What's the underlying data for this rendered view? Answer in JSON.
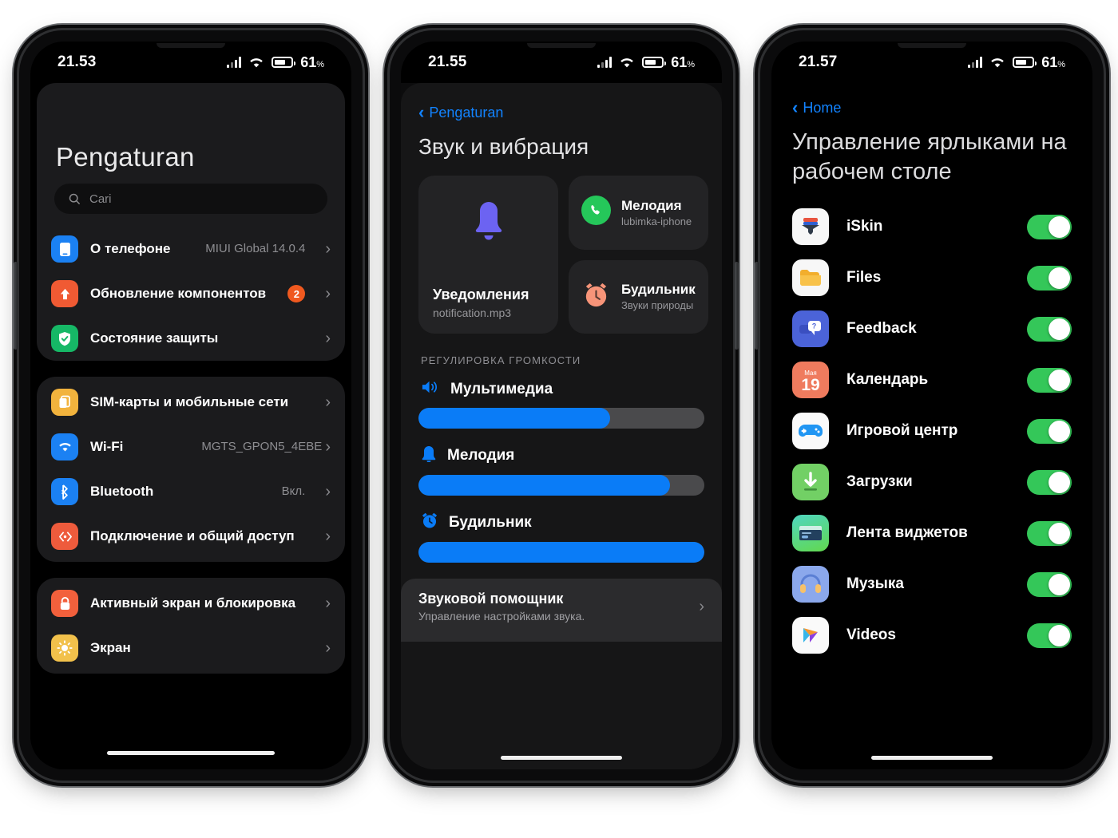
{
  "statusbar": {
    "time_phone1": "21.53",
    "time_phone2": "21.55",
    "time_phone3": "21.57",
    "battery_pct": "61",
    "battery_unit": "%"
  },
  "phone1": {
    "title": "Pengaturan",
    "search_placeholder": "Cari",
    "groups": [
      {
        "rows": [
          {
            "icon": "phone-info-icon",
            "label": "О телефоне",
            "value": "MIUI Global 14.0.4",
            "badge": "",
            "chevron": "›",
            "icon_color": "#1b81f3"
          },
          {
            "icon": "component-update-icon",
            "label": "Обновление компонентов",
            "value": "",
            "badge": "2",
            "chevron": "›",
            "icon_color": "#f05a33"
          },
          {
            "icon": "security-shield-icon",
            "label": "Состояние защиты",
            "value": "",
            "badge": "",
            "chevron": "›",
            "icon_color": "#16b866"
          }
        ]
      },
      {
        "rows": [
          {
            "icon": "sim-card-icon",
            "label": "SIM-карты и мобильные сети",
            "value": "",
            "badge": "",
            "chevron": "›",
            "icon_color": "#f2b33d"
          },
          {
            "icon": "wifi-icon",
            "label": "Wi-Fi",
            "value": "MGTS_GPON5_4EBE",
            "badge": "",
            "chevron": "›",
            "icon_color": "#1b81f3"
          },
          {
            "icon": "bluetooth-icon",
            "label": "Bluetooth",
            "value": "Вкл.",
            "badge": "",
            "chevron": "›",
            "icon_color": "#1b81f3"
          },
          {
            "icon": "connection-sharing-icon",
            "label": "Подключение и общий доступ",
            "value": "",
            "badge": "",
            "chevron": "›",
            "icon_color": "#ee5b3c"
          }
        ]
      },
      {
        "rows": [
          {
            "icon": "lock-screen-icon",
            "label": "Активный экран и блокировка",
            "value": "",
            "badge": "",
            "chevron": "›",
            "icon_color": "#f2603c"
          },
          {
            "icon": "display-brightness-icon",
            "label": "Экран",
            "value": "",
            "badge": "",
            "chevron": "›",
            "icon_color": "#f2c14b"
          }
        ]
      }
    ]
  },
  "phone2": {
    "back_label": "Pengaturan",
    "title": "Звук и вибрация",
    "tiles": {
      "notifications": {
        "title": "Уведомления",
        "subtitle": "notification.mp3",
        "icon": "bell-icon"
      },
      "ringtone": {
        "title": "Мелодия",
        "subtitle": "lubimka-iphone",
        "icon": "phone-call-icon"
      },
      "alarm": {
        "title": "Будильник",
        "subtitle": "Звуки природы",
        "icon": "alarm-clock-icon"
      }
    },
    "section_label": "РЕГУЛИРОВКА ГРОМКОСТИ",
    "sliders": [
      {
        "label": "Мультимедиа",
        "icon": "speaker-icon",
        "percent": 67
      },
      {
        "label": "Мелодия",
        "icon": "bell-icon",
        "percent": 88
      },
      {
        "label": "Будильник",
        "icon": "alarm-clock-icon",
        "percent": 100
      }
    ],
    "bottom_card": {
      "title": "Звуковой помощник",
      "subtitle": "Управление настройками звука.",
      "chevron": "›"
    }
  },
  "phone3": {
    "back_label": "Home",
    "title": "Управление ярлыками на рабочем столе",
    "apps": [
      {
        "name": "iSkin",
        "icon": "iskin-icon",
        "enabled": true
      },
      {
        "name": "Files",
        "icon": "files-folder-icon",
        "enabled": true
      },
      {
        "name": "Feedback",
        "icon": "feedback-chat-icon",
        "enabled": true
      },
      {
        "name": "Календарь",
        "icon": "calendar-icon",
        "enabled": true,
        "calendar_month": "Мая",
        "calendar_day": "19"
      },
      {
        "name": "Игровой центр",
        "icon": "game-controller-icon",
        "enabled": true
      },
      {
        "name": "Загрузки",
        "icon": "downloads-icon",
        "enabled": true
      },
      {
        "name": "Лента виджетов",
        "icon": "widgets-feed-icon",
        "enabled": true
      },
      {
        "name": "Музыка",
        "icon": "music-headphones-icon",
        "enabled": true
      },
      {
        "name": "Videos",
        "icon": "videos-play-icon",
        "enabled": true
      }
    ]
  },
  "colors": {
    "accent_blue": "#0a7cf7",
    "link_blue": "#1283ff",
    "toggle_green": "#34c759",
    "badge_orange": "#f0591f"
  }
}
